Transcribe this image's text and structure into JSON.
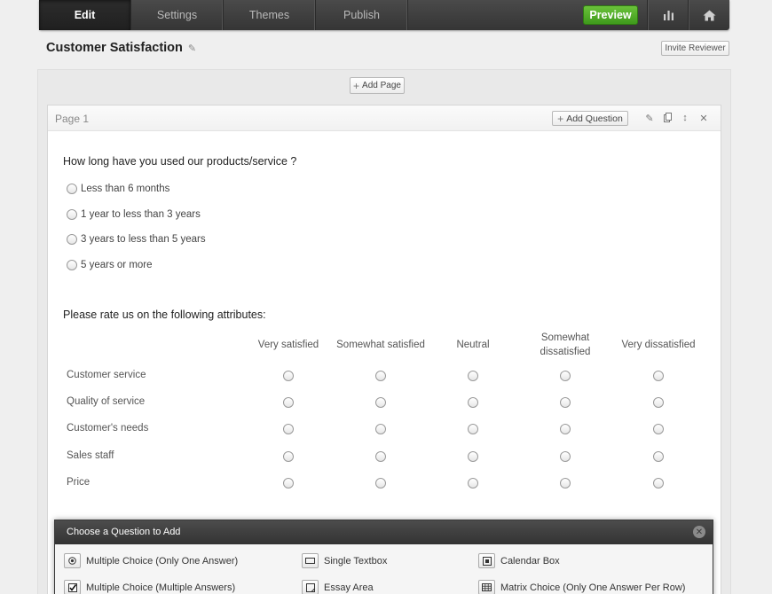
{
  "nav": {
    "tabs": [
      "Edit",
      "Settings",
      "Themes",
      "Publish"
    ],
    "active_tab": "Edit",
    "preview_label": "Preview"
  },
  "survey": {
    "title": "Customer Satisfaction",
    "invite_label": "Invite Reviewer",
    "add_page_label": "Add Page"
  },
  "page": {
    "label": "Page 1",
    "add_question_label": "Add Question"
  },
  "question1": {
    "text": "How long have you used our products/service ?",
    "options": [
      "Less than 6 months",
      "1 year to less than 3 years",
      "3 years to less than 5 years",
      "5 years or more"
    ]
  },
  "question2": {
    "text": "Please rate us on the following attributes:",
    "columns": [
      "Very satisfied",
      "Somewhat satisfied",
      "Neutral",
      "Somewhat\ndissatisfied",
      "Very dissatisfied"
    ],
    "rows": [
      "Customer service",
      "Quality of service",
      "Customer's needs",
      "Sales staff",
      "Price"
    ]
  },
  "chooser": {
    "title": "Choose a Question to Add",
    "types": [
      {
        "label": "Multiple Choice (Only One Answer)",
        "icon": "radio-icon"
      },
      {
        "label": "Single Textbox",
        "icon": "textbox-icon"
      },
      {
        "label": "Calendar Box",
        "icon": "calendar-icon"
      },
      {
        "label": "Multiple Choice (Multiple Answers)",
        "icon": "checkbox-icon"
      },
      {
        "label": "Essay Area",
        "icon": "essay-icon"
      },
      {
        "label": "Matrix Choice (Only One Answer Per Row)",
        "icon": "matrix-icon"
      }
    ]
  },
  "colors": {
    "nav_bg": "#3d3d3d",
    "preview_green": "#4ea829",
    "page_bg": "#ffffff"
  }
}
